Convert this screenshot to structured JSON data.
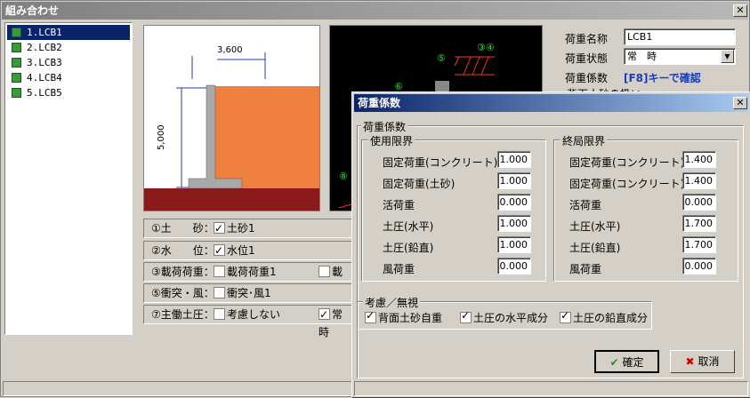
{
  "window": {
    "title": "組み合わせ",
    "close": "✕"
  },
  "list": [
    "1.LCB1",
    "2.LCB2",
    "3.LCB3",
    "4.LCB4",
    "5.LCB5"
  ],
  "drawing": {
    "dim_width": "3,600",
    "dim_height": "5,000"
  },
  "cad": {
    "m3": "③④",
    "m5": "⑤",
    "m6": "⑥",
    "m8": "⑧"
  },
  "cond": {
    "r1": {
      "label": "①土　　砂：",
      "opt1": "土砂1"
    },
    "r2": {
      "label": "②水　　位：",
      "opt1": "水位1"
    },
    "r3": {
      "label": "③載荷荷重：",
      "opt1": "載荷荷重1",
      "opt2": "載"
    },
    "r4": {
      "label": "⑤衝突・風：",
      "opt1": "衝突･風1"
    },
    "r5": {
      "label": "⑦主働土圧：",
      "opt1": "考慮しない",
      "opt2": "常時"
    }
  },
  "right": {
    "name_label": "荷重名称",
    "name_value": "LCB1",
    "state_label": "荷重状態",
    "state_value": "常　時",
    "coef_label": "荷重係数",
    "coef_hint": "[F8]キーで確認",
    "partial": "背面土砂の扱い"
  },
  "dialog": {
    "title": "荷重係数",
    "close": "✕",
    "group": "荷重係数",
    "service": {
      "title": "使用限界",
      "rows": [
        {
          "label": "固定荷重(コンクリート)",
          "value": "1.000"
        },
        {
          "label": "固定荷重(土砂)",
          "value": "1.000"
        },
        {
          "label": "活荷重",
          "value": "0.000"
        },
        {
          "label": "土圧(水平)",
          "value": "1.000"
        },
        {
          "label": "土圧(鉛直)",
          "value": "1.000"
        },
        {
          "label": "風荷重",
          "value": "0.000"
        }
      ]
    },
    "ultimate": {
      "title": "終局限界",
      "rows": [
        {
          "label": "固定荷重(コンクリート)",
          "value": "1.400"
        },
        {
          "label": "固定荷重(コンクリート)",
          "value": "1.400"
        },
        {
          "label": "活荷重",
          "value": "0.000"
        },
        {
          "label": "土圧(水平)",
          "value": "1.700"
        },
        {
          "label": "土圧(鉛直)",
          "value": "1.700"
        },
        {
          "label": "風荷重",
          "value": "0.000"
        }
      ]
    },
    "consider": {
      "title": "考慮／無視",
      "items": [
        "背面土砂自重",
        "土圧の水平成分",
        "土圧の鉛直成分"
      ]
    },
    "ok": "確定",
    "cancel": "取消"
  },
  "colors": {
    "soil": "#f08040",
    "ground": "#8b1a1a",
    "accent": "#0a246a"
  }
}
